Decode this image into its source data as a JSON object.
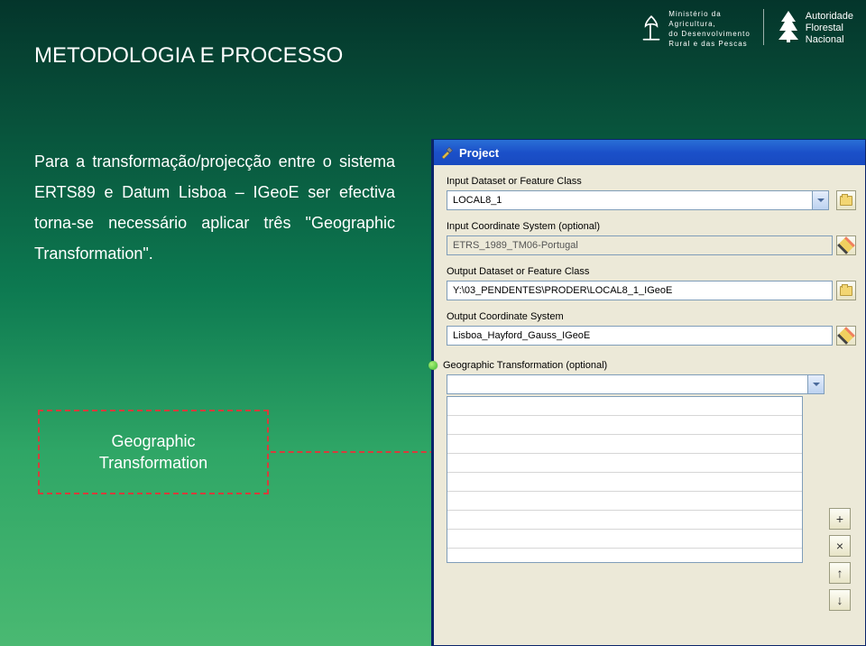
{
  "header": {
    "ministry_lines": [
      "Ministério da",
      "Agricultura,",
      "do Desenvolvimento",
      "Rural e das Pescas"
    ],
    "afn_lines": [
      "Autoridade",
      "Florestal",
      "Nacional"
    ]
  },
  "slide": {
    "title": "METODOLOGIA E PROCESSO",
    "body": "Para a transformação/projecção entre o sistema ERTS89 e Datum Lisboa – IGeoE ser efectiva torna-se necessário aplicar três \"Geographic Transformation\"."
  },
  "callout": {
    "line1": "Geographic",
    "line2": "Transformation"
  },
  "dialog": {
    "title": "Project",
    "fields": {
      "input_dataset": {
        "label": "Input Dataset or Feature Class",
        "value": "LOCAL8_1"
      },
      "input_cs": {
        "label": "Input Coordinate System (optional)",
        "value": "ETRS_1989_TM06-Portugal"
      },
      "output_dataset": {
        "label": "Output Dataset or Feature Class",
        "value": "Y:\\03_PENDENTES\\PRODER\\LOCAL8_1_IGeoE"
      },
      "output_cs": {
        "label": "Output Coordinate System",
        "value": "Lisboa_Hayford_Gauss_IGeoE"
      },
      "geo_trans": {
        "label": "Geographic Transformation (optional)",
        "value": ""
      }
    },
    "side_buttons": [
      "+",
      "×",
      "↑",
      "↓"
    ]
  }
}
